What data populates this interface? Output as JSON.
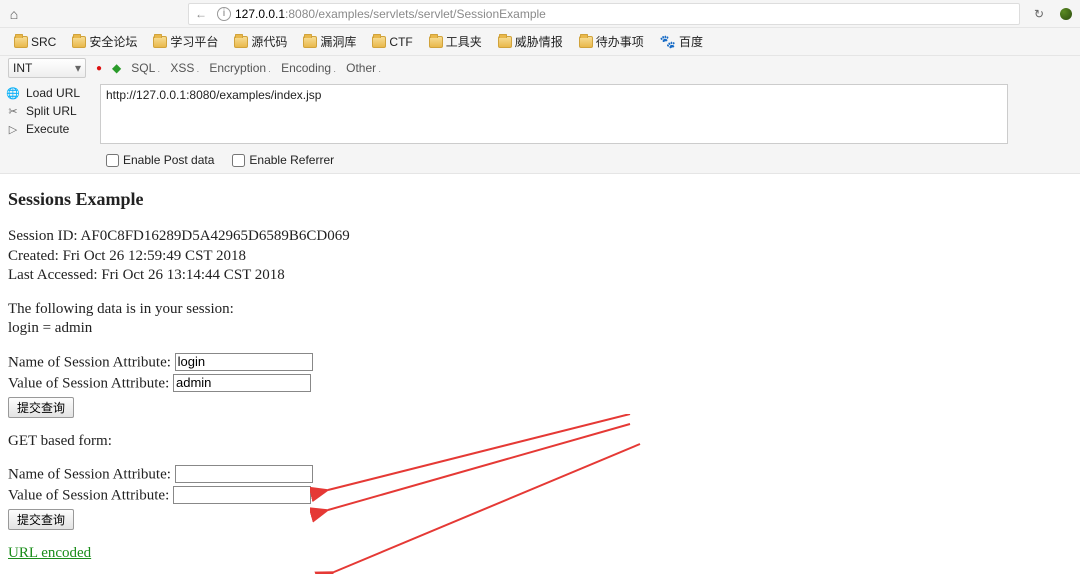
{
  "topbar": {
    "back_glyph": "←",
    "info_char": "i",
    "url_host": "127.0.0.1",
    "url_port_path": ":8080/examples/servlets/servlet/SessionExample",
    "reload_glyph": "↻"
  },
  "bookmarks": [
    {
      "label": "SRC",
      "type": "folder"
    },
    {
      "label": "安全论坛",
      "type": "folder"
    },
    {
      "label": "学习平台",
      "type": "folder"
    },
    {
      "label": "源代码",
      "type": "folder"
    },
    {
      "label": "漏洞库",
      "type": "folder"
    },
    {
      "label": "CTF",
      "type": "folder"
    },
    {
      "label": "工具夹",
      "type": "folder"
    },
    {
      "label": "威胁情报",
      "type": "folder"
    },
    {
      "label": "待办事项",
      "type": "folder"
    },
    {
      "label": "百度",
      "type": "paw"
    }
  ],
  "hackbar": {
    "selector": "INT",
    "menus": [
      "SQL",
      "XSS",
      "Encryption",
      "Encoding",
      "Other"
    ],
    "side": {
      "load": "Load URL",
      "split": "Split URL",
      "execute": "Execute"
    },
    "input": "http://127.0.0.1:8080/examples/index.jsp",
    "check_post": "Enable Post data",
    "check_ref": "Enable Referrer"
  },
  "page": {
    "title": "Sessions Example",
    "sess_id_label": "Session ID: ",
    "sess_id": "AF0C8FD16289D5A42965D6589B6CD069",
    "created_label": "Created: ",
    "created": "Fri Oct 26 12:59:49 CST 2018",
    "last_label": "Last Accessed: ",
    "last": "Fri Oct 26 13:14:44 CST 2018",
    "data_intro": "The following data is in your session:",
    "data_line": "login = admin",
    "name_label": "Name of Session Attribute:",
    "value_label": "Value of Session Attribute:",
    "name_val": "login",
    "value_val": "admin",
    "submit": "提交查询",
    "get_heading": "GET based form:",
    "link_enc": "URL encoded"
  }
}
